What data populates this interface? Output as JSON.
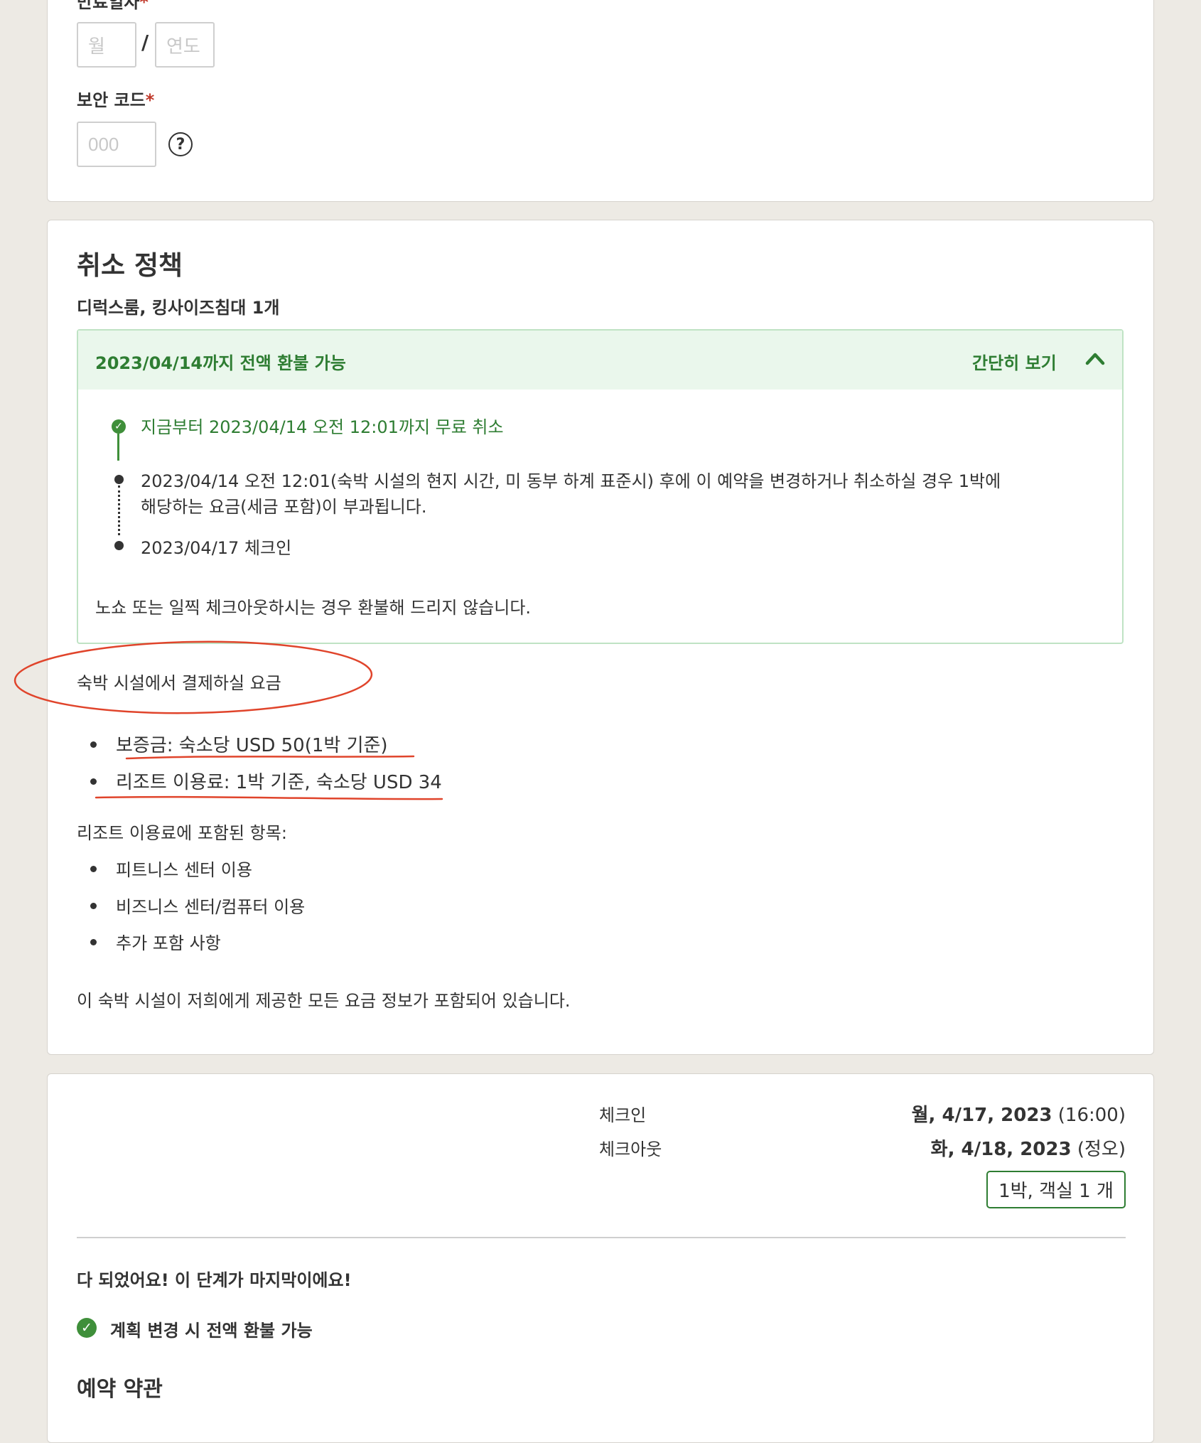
{
  "payment": {
    "expiry_label": "만료일자",
    "required_mark": "*",
    "month_placeholder": "월",
    "slash": "/",
    "year_placeholder": "연도",
    "cvv_label": "보안 코드",
    "cvv_placeholder": "000",
    "help_glyph": "?"
  },
  "cancellation": {
    "title": "취소 정책",
    "room": "디럭스룸, 킹사이즈침대 1개",
    "refund_header": "2023/04/14까지 전액 환불 가능",
    "toggle_label": "간단히 보기",
    "timeline": [
      "지금부터 2023/04/14 오전 12:01까지 무료 취소",
      "2023/04/14 오전 12:01(숙박 시설의 현지 시간, 미 동부 하계 표준시) 후에 이 예약을 변경하거나 취소하실 경우 1박에",
      "해당하는 요금(세금 포함)이 부과됩니다.",
      "2023/04/17 체크인"
    ],
    "no_show": "노쇼 또는 일찍 체크아웃하시는 경우 환불해 드리지 않습니다.",
    "pay_at_property_title": "숙박 시설에서 결제하실 요금",
    "fees": [
      "보증금: 숙소당 USD 50(1박 기준)",
      "리조트 이용료: 1박 기준, 숙소당 USD 34"
    ],
    "included_title": "리조트 이용료에 포함된 항목:",
    "included": [
      "피트니스 센터 이용",
      "비즈니스 센터/컴퓨터 이용",
      "추가 포함 사항"
    ],
    "footer_note": "이 숙박 시설이 저희에게 제공한 모든 요금 정보가 포함되어 있습니다."
  },
  "booking": {
    "checkin_label": "체크인",
    "checkin_date": "월, 4/17, 2023",
    "checkin_time": "(16:00)",
    "checkout_label": "체크아웃",
    "checkout_date": "화, 4/18, 2023",
    "checkout_time": "(정오)",
    "nights_badge": "1박, 객실 1 개",
    "final_step": "다 되었어요! 이 단계가 마지막이에요!",
    "refund_feature": "계획 변경 시 전액 환불 가능",
    "terms_title": "예약 약관"
  },
  "colors": {
    "green": "#2e7d32",
    "annotation_red": "#e0442b",
    "background": "#edeae4"
  }
}
